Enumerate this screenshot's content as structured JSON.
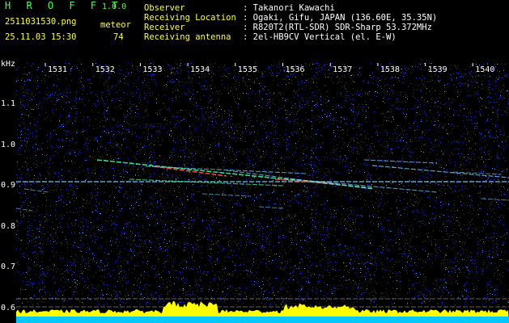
{
  "app": {
    "title": "H R O F F T",
    "version": "1.0.0"
  },
  "file": {
    "name": "2511031530.png",
    "timestamp": "25.11.03 15:30"
  },
  "meteor": {
    "label": "meteor",
    "count": "74"
  },
  "info": [
    {
      "label": "Observer",
      "value": ": Takanori Kawachi"
    },
    {
      "label": "Receiving Location",
      "value": ": Ogaki, Gifu, JAPAN (136.60E, 35.35N)"
    },
    {
      "label": "Receiver",
      "value": ": R820T2(RTL-SDR) SDR-Sharp 53.372MHz"
    },
    {
      "label": "Receiving antenna",
      "value": ": 2el-HB9CV Vertical (el. E-W)"
    }
  ],
  "axes": {
    "y_unit": "kHz",
    "y_ticks": [
      "1.1",
      "1.0",
      "0.9",
      "0.8",
      "0.7",
      "0.6"
    ],
    "x_ticks": [
      "1531",
      "1532",
      "1533",
      "1534",
      "1535",
      "1536",
      "1537",
      "1538",
      "1539",
      "1540"
    ]
  },
  "colors": {
    "background": "#000000",
    "noise": "#2b2bd0",
    "carrier": "#7fd6ff",
    "echo_strong": "#ff5050",
    "echo_medium": "#40ffa0",
    "activity_bar": "#ffff00",
    "activity_base": "#00c8ff",
    "header_green": "#4cff4c"
  }
}
